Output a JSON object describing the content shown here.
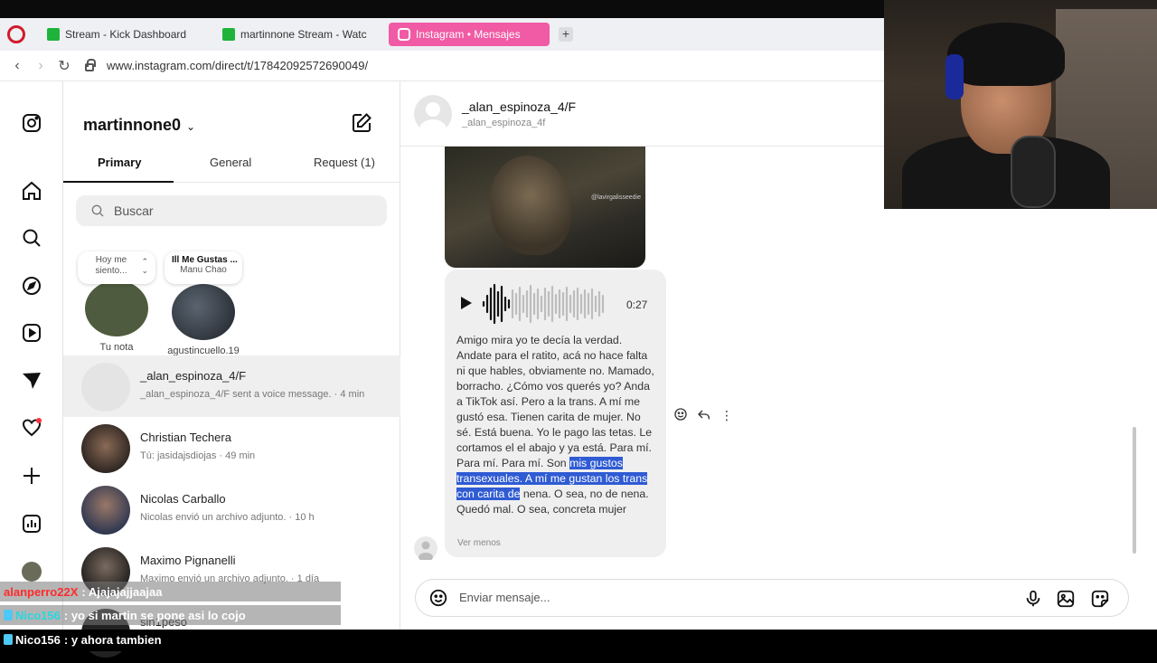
{
  "browser": {
    "tabs": [
      {
        "label": "Stream - Kick Dashboard",
        "favicon_color": "#1fb33a"
      },
      {
        "label": "martinnone Stream - Watc",
        "favicon_color": "#1fb33a"
      },
      {
        "label": "Instagram • Mensajes",
        "favicon_color": "#ffffff"
      }
    ],
    "new_tab": "+",
    "url": "www.instagram.com/direct/t/17842092572690049/"
  },
  "inbox": {
    "account": "martinnone0",
    "tabs": [
      "Primary",
      "General",
      "Request (1)"
    ],
    "search_placeholder": "Buscar",
    "notes": [
      {
        "bubble": "Hoy me siento...",
        "label": "Tu nota"
      },
      {
        "bubble_title": "Ill Me Gustas ...",
        "bubble_sub": "Manu Chao",
        "label": "agustincuello.19"
      }
    ],
    "conversations": [
      {
        "name": "_alan_espinoza_4/F",
        "preview": "_alan_espinoza_4/F sent a voice message. · 4 min"
      },
      {
        "name": "Christian Techera",
        "preview": "Tú: jasidajsdiojas · 49 min"
      },
      {
        "name": "Nicolas Carballo",
        "preview": "Nicolas envió un archivo adjunto. · 10 h"
      },
      {
        "name": "Maximo Pignanelli",
        "preview": "Maximo envió un archivo adjunto. · 1 día"
      },
      {
        "name": "sin1peso",
        "preview": ""
      }
    ]
  },
  "thread": {
    "name": "_alan_espinoza_4/F",
    "username": "_alan_espinoza_4f",
    "media_watermark": "@lavirgalisseedie",
    "voice_duration": "0:27",
    "transcript_before": "Amigo mira yo te decía la verdad. Andate para el ratito, acá no hace falta ni que hables, obviamente no. Mamado, borracho. ¿Cómo vos querés yo? Anda a TikTok así. Pero a la trans. A mí me gustó esa. Tienen carita de mujer. No sé. Está buena. Yo le pago las tetas. Le cortamos el el abajo y ya está. Para mí. Para mí. Para mí. Son ",
    "transcript_highlight": "mis gustos transexuales. A mí me gustan los trans con carita de",
    "transcript_after": " nena. O sea, no de nena. Quedó mal. O sea, concreta mujer",
    "see_less": "Ver menos",
    "composer_placeholder": "Enviar mensaje...",
    "actions": {
      "more": "⋮"
    }
  },
  "stream_chat": [
    {
      "user": "alanperro22X",
      "text": ": Ajajajajjaajaa",
      "user_color": "#ff2b2b"
    },
    {
      "user": "Nico156",
      "text": ": yo si martin se pone asi lo cojo",
      "user_color": "#27d8e0"
    },
    {
      "user": "Nico156",
      "text": ": y ahora tambien",
      "user_color": "#ffffff"
    }
  ],
  "colors": {
    "accent_tab": "#f15aa4",
    "highlight": "#2f5bd3",
    "notification": "#ff3040"
  }
}
